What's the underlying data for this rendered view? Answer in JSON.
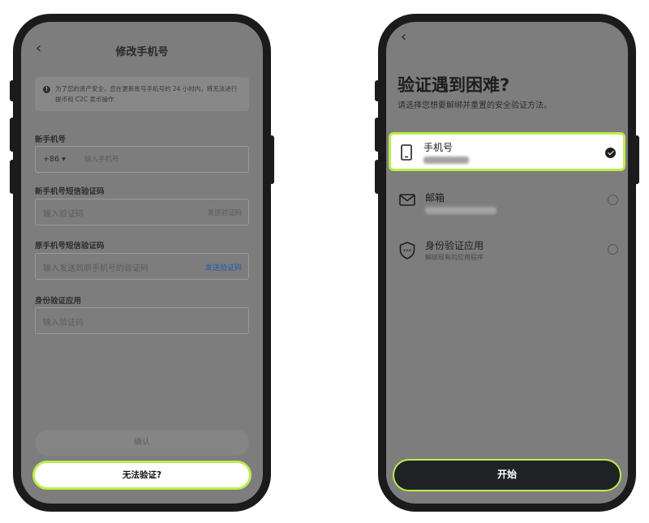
{
  "left": {
    "header": {
      "back": "‹",
      "title": "修改手机号"
    },
    "notice": {
      "icon": "info-icon",
      "text": "为了您的资产安全，您在更新账号手机号的 24 小时内，将无法进行提币和 C2C 卖币操作"
    },
    "fields": [
      {
        "label": "新手机号",
        "prefix": "+86 ▾",
        "placeholder": "输入手机号"
      },
      {
        "label": "新手机号短信验证码",
        "placeholder": "输入验证码",
        "action": "发送验证码"
      },
      {
        "label": "原手机号短信验证码",
        "placeholder": "输入发送到原手机号的验证码",
        "action": "发送验证码"
      },
      {
        "label": "身份验证应用",
        "placeholder": "输入验证码"
      }
    ],
    "confirm_label": "确认",
    "cannot_verify_label": "无法验证?"
  },
  "right": {
    "header": {
      "back": "‹"
    },
    "title": "验证遇到困难?",
    "subtitle": "请选择您想要解绑并重置的安全验证方法。",
    "options": [
      {
        "name": "手机号",
        "icon": "phone-icon",
        "selected": true
      },
      {
        "name": "邮箱",
        "icon": "mail-icon",
        "selected": false
      },
      {
        "name": "身份验证应用",
        "desc": "解绑现有的应用程序",
        "icon": "shield-icon",
        "selected": false
      }
    ],
    "start_label": "开始"
  },
  "colors": {
    "accent": "#b9ee4a",
    "dark_button": "#1f2224",
    "link": "#1e5ea8"
  }
}
